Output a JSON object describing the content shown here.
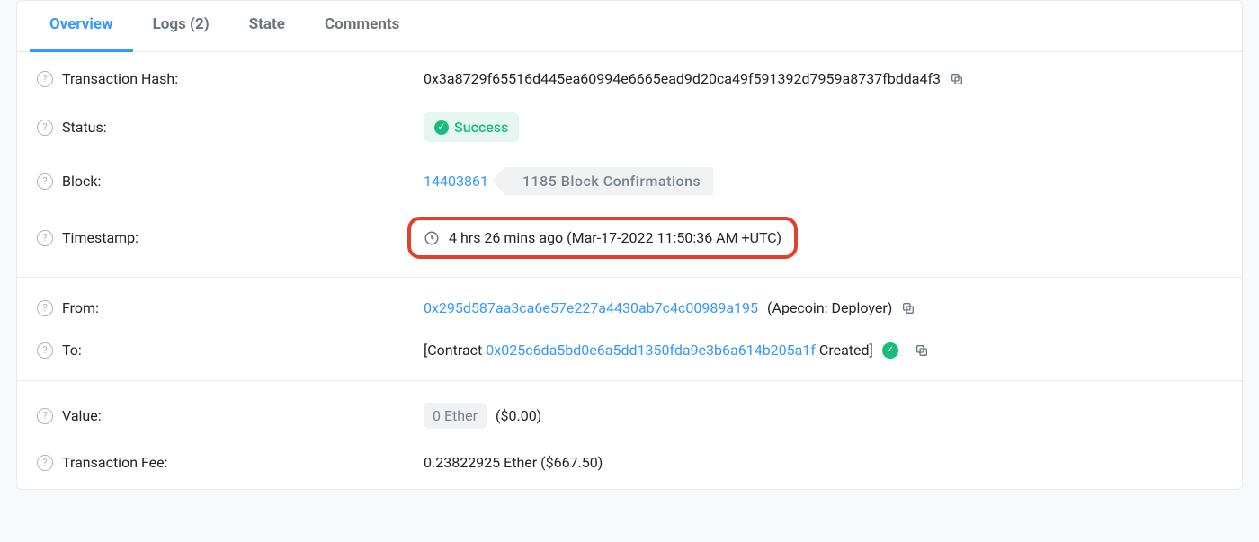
{
  "tabs": {
    "overview": "Overview",
    "logs": "Logs (2)",
    "state": "State",
    "comments": "Comments"
  },
  "labels": {
    "txhash": "Transaction Hash:",
    "status": "Status:",
    "block": "Block:",
    "timestamp": "Timestamp:",
    "from": "From:",
    "to": "To:",
    "value": "Value:",
    "fee": "Transaction Fee:"
  },
  "txhash": "0x3a8729f65516d445ea60994e6665ead9d20ca49f591392d7959a8737fbdda4f3",
  "status": "Success",
  "block": {
    "number": "14403861",
    "confirmations": "1185 Block Confirmations"
  },
  "timestamp": "4 hrs 26 mins ago (Mar-17-2022 11:50:36 AM +UTC)",
  "from": {
    "address": "0x295d587aa3ca6e57e227a4430ab7c4c00989a195",
    "name": "(Apecoin: Deployer)"
  },
  "to": {
    "prefix": "[Contract ",
    "address": "0x025c6da5bd0e6a5dd1350fda9e3b6a614b205a1f",
    "suffix": " Created]"
  },
  "value": {
    "pill": "0 Ether",
    "usd": "($0.00)"
  },
  "fee": "0.23822925 Ether ($667.50)"
}
